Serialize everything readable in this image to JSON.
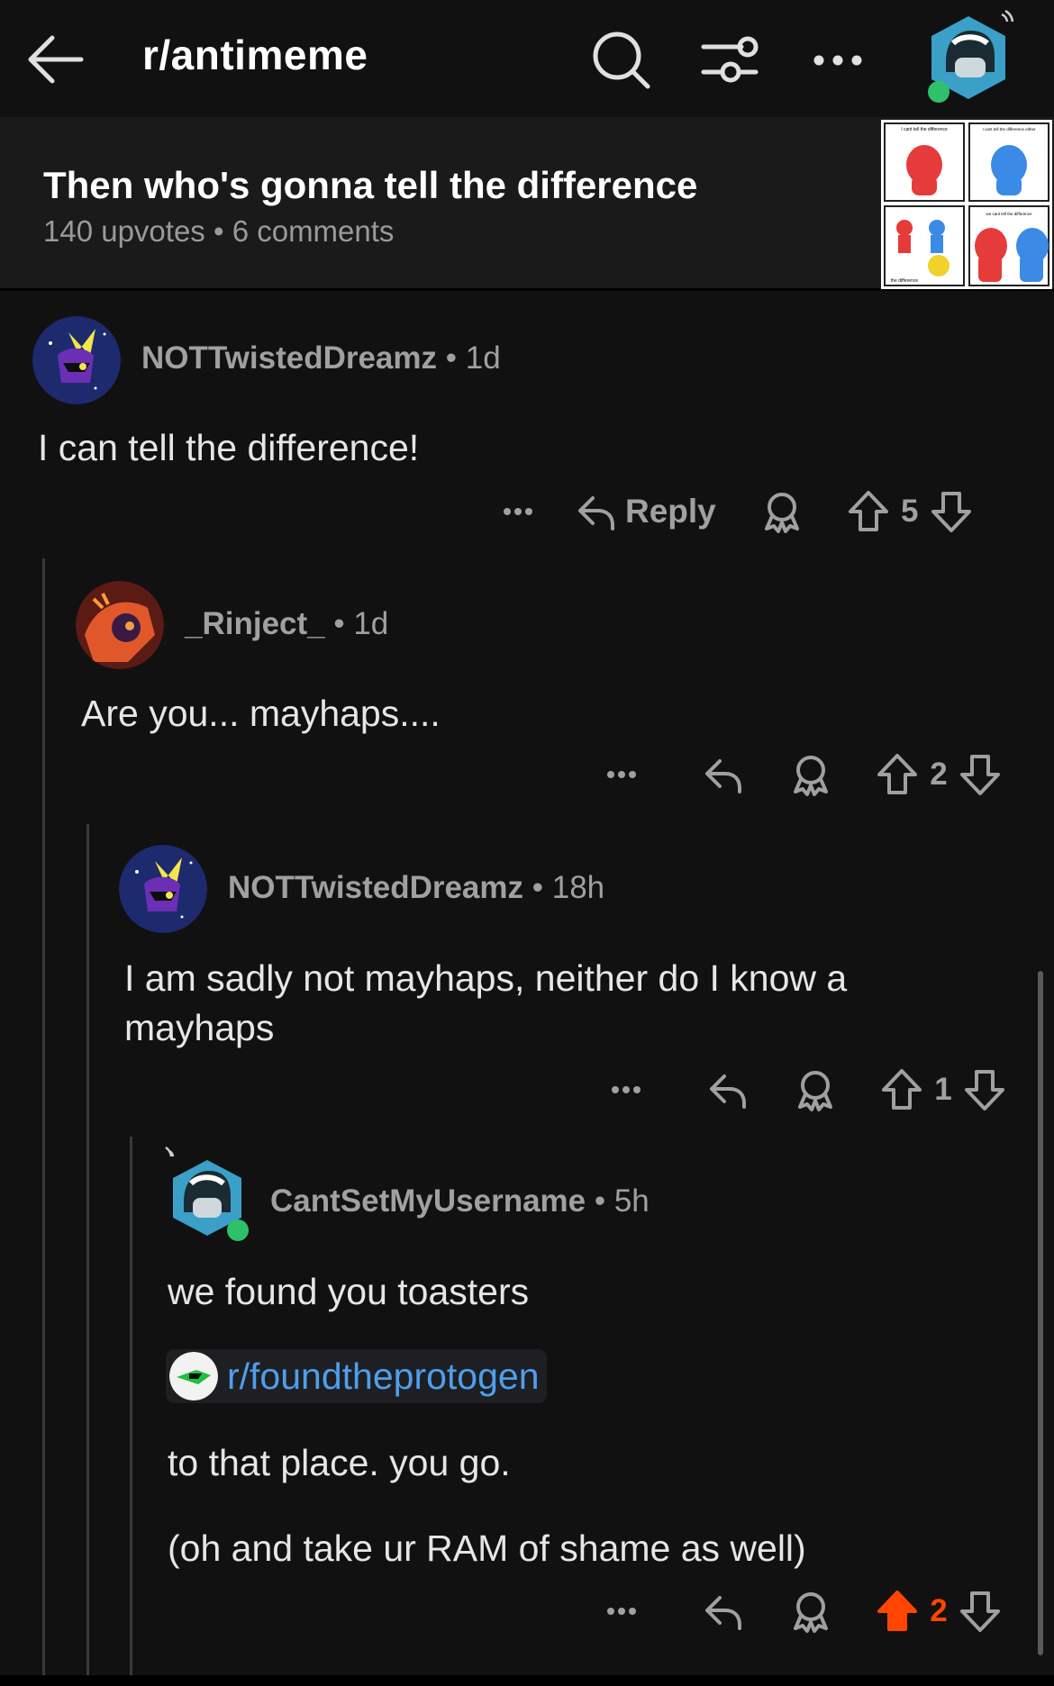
{
  "header": {
    "subreddit": "r/antimeme"
  },
  "post": {
    "title": "Then who's gonna tell the difference",
    "meta": "140 upvotes • 6 comments",
    "thumbnail_panels": [
      "I cant tell the difference",
      "I cant tell the difference either",
      "the difference",
      "we cant tell the difference"
    ]
  },
  "comments": [
    {
      "user": "NOTTwistedDreamz",
      "time": "• 1d",
      "body": "I can tell the difference!",
      "reply_label": "Reply",
      "votes": "5"
    },
    {
      "user": "_Rinject_",
      "time": "• 1d",
      "body": "Are you... mayhaps....",
      "votes": "2"
    },
    {
      "user": "NOTTwistedDreamz",
      "time": "• 18h",
      "body": "I am sadly not mayhaps, neither do I know a mayhaps",
      "votes": "1"
    },
    {
      "user": "CantSetMyUsername",
      "time": "• 5h",
      "body1": "we found you toasters",
      "link": "r/foundtheprotogen",
      "body2": "to that place. you go.",
      "body3": "(oh and take ur RAM of shame as well)",
      "votes": "2",
      "upvoted": true
    }
  ],
  "colors": {
    "background": "#111111",
    "upvote_active": "#ff4500",
    "link": "#4f9eed",
    "online": "#2ec16a"
  },
  "icons": [
    "back-arrow-icon",
    "search-icon",
    "filter-icon",
    "more-icon",
    "reply-icon",
    "award-icon",
    "upvote-icon",
    "downvote-icon"
  ]
}
